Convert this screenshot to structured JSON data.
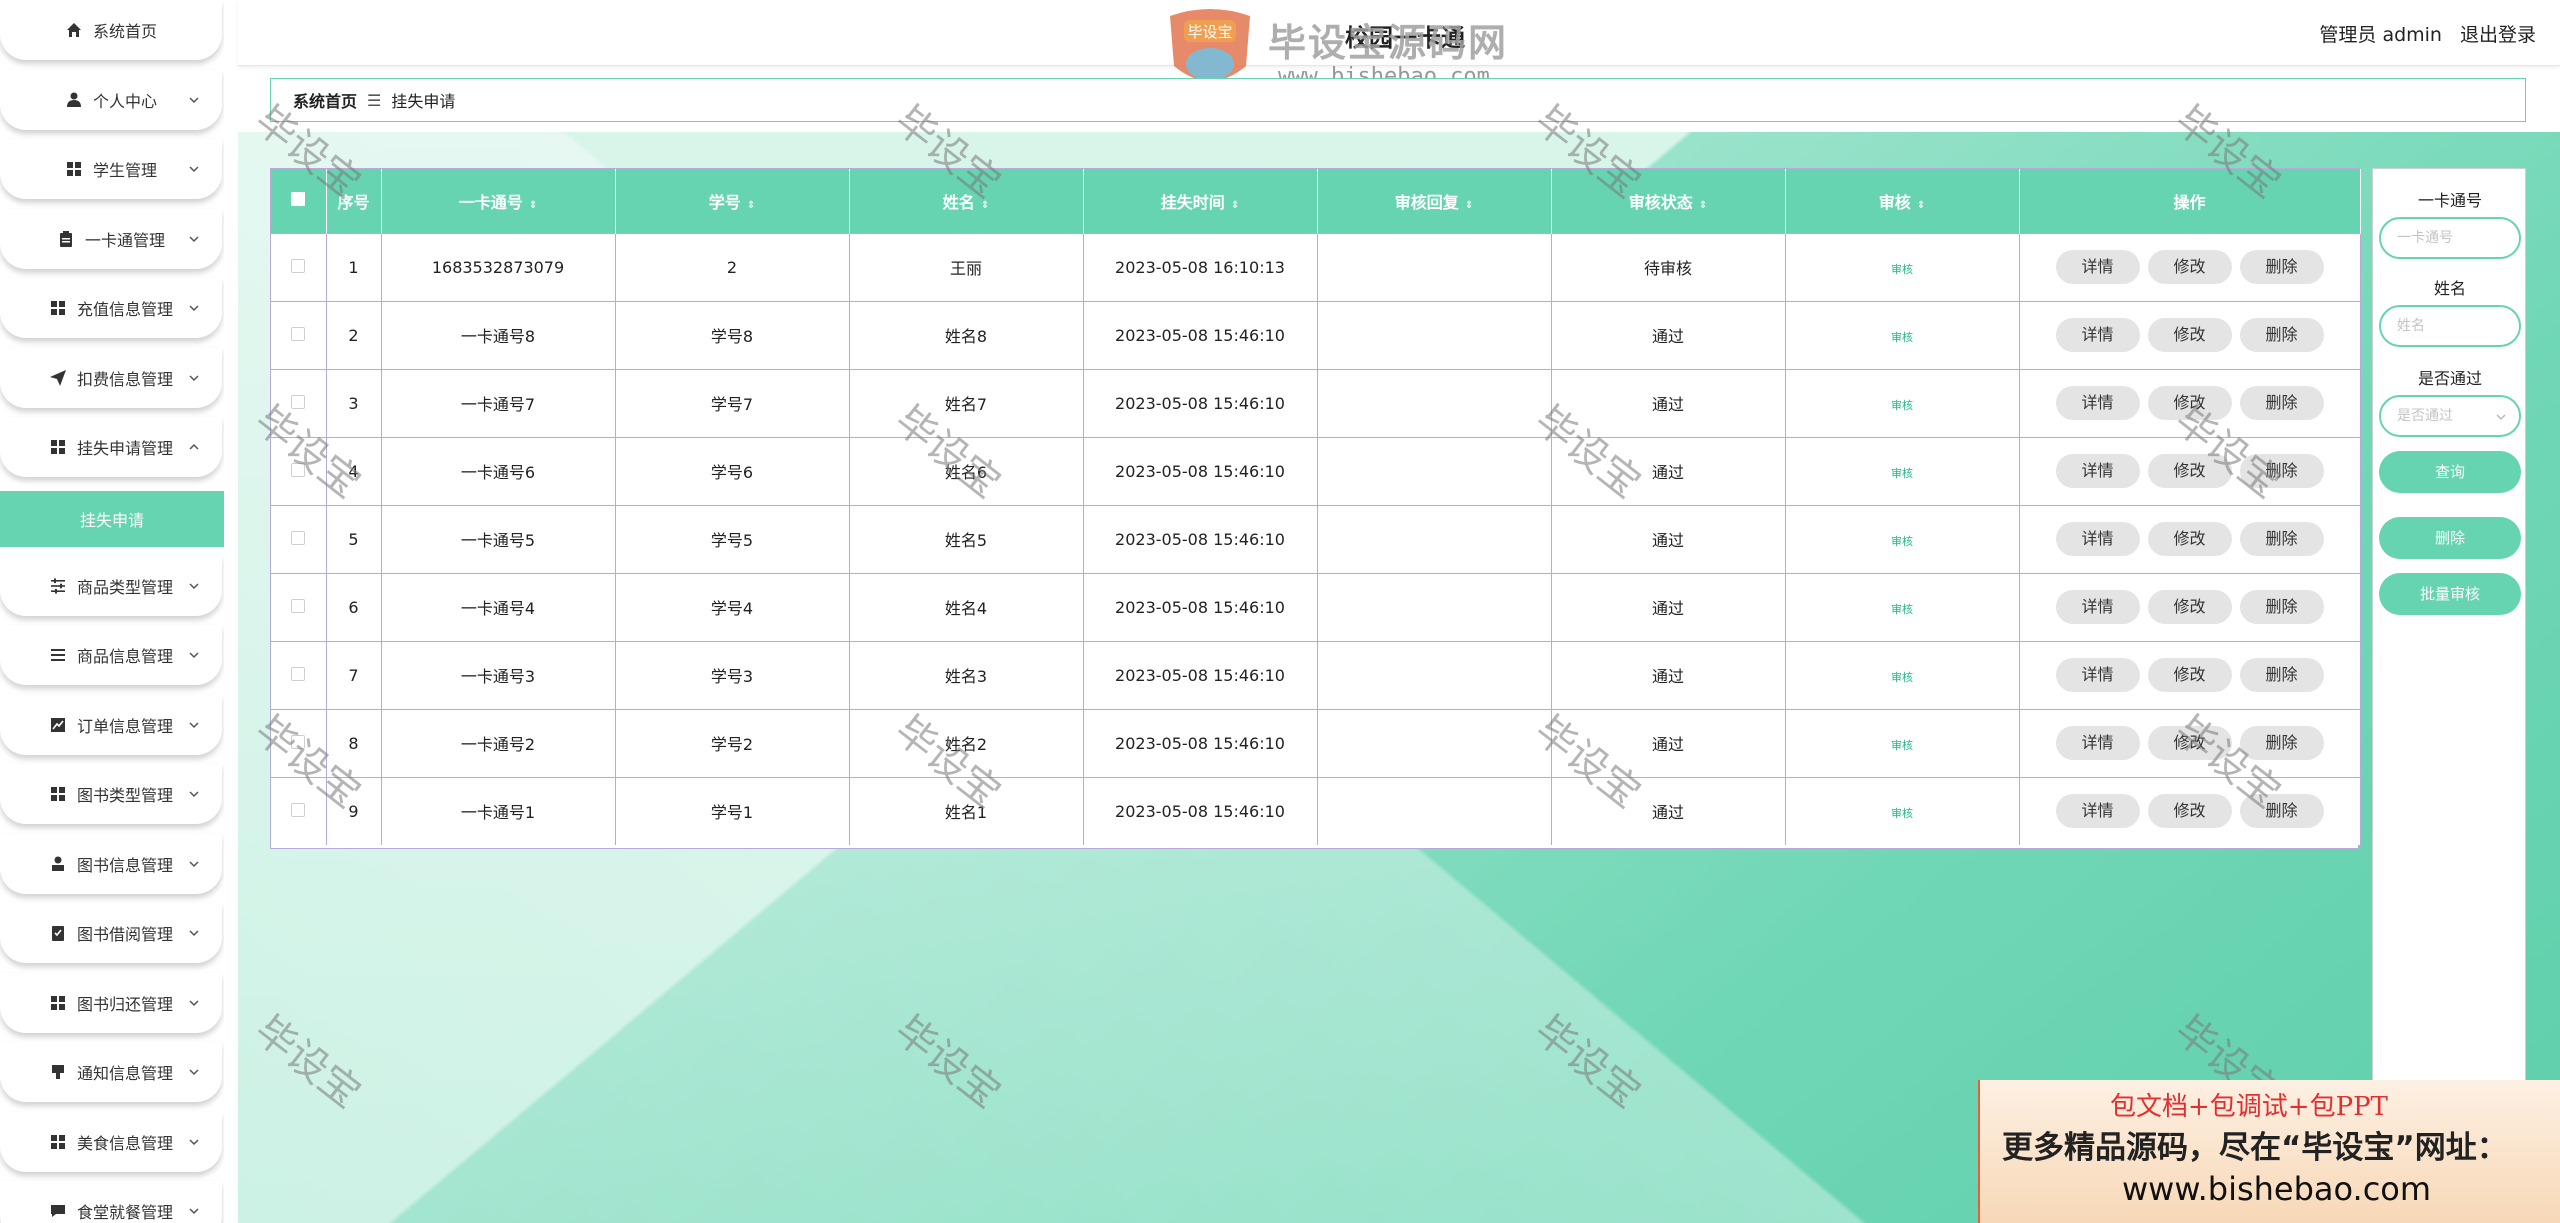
{
  "sidebar": {
    "items": [
      {
        "label": "系统首页",
        "icon": "home-icon",
        "chevron": false
      },
      {
        "label": "个人中心",
        "icon": "user-icon",
        "chevron": true
      },
      {
        "label": "学生管理",
        "icon": "grid-icon",
        "chevron": true
      },
      {
        "label": "一卡通管理",
        "icon": "clipboard-icon",
        "chevron": true
      },
      {
        "label": "充值信息管理",
        "icon": "grid-icon",
        "chevron": true
      },
      {
        "label": "扣费信息管理",
        "icon": "send-icon",
        "chevron": true
      },
      {
        "label": "挂失申请管理",
        "icon": "grid-icon",
        "chevron": true,
        "expanded": true
      },
      {
        "label": "商品类型管理",
        "icon": "sliders-icon",
        "chevron": true
      },
      {
        "label": "商品信息管理",
        "icon": "list-icon",
        "chevron": true
      },
      {
        "label": "订单信息管理",
        "icon": "chart-icon",
        "chevron": true
      },
      {
        "label": "图书类型管理",
        "icon": "grid-icon",
        "chevron": true
      },
      {
        "label": "图书信息管理",
        "icon": "person-icon",
        "chevron": true
      },
      {
        "label": "图书借阅管理",
        "icon": "checklist-icon",
        "chevron": true
      },
      {
        "label": "图书归还管理",
        "icon": "grid-icon",
        "chevron": true
      },
      {
        "label": "通知信息管理",
        "icon": "bell-icon",
        "chevron": true
      },
      {
        "label": "美食信息管理",
        "icon": "grid-icon",
        "chevron": true
      },
      {
        "label": "食堂就餐管理",
        "icon": "message-icon",
        "chevron": true
      }
    ],
    "active_sub": "挂失申请"
  },
  "header": {
    "title": "校园一卡通",
    "user_label": "管理员 admin",
    "logout_label": "退出登录"
  },
  "watermark": {
    "brand": "毕设宝源码网",
    "badge": "毕设宝",
    "url": "www.bishebao.com",
    "stamp": "毕设宝"
  },
  "breadcrumb": {
    "home": "系统首页",
    "separator": "☰",
    "current": "挂失申请"
  },
  "table": {
    "columns": [
      "序号",
      "一卡通号",
      "学号",
      "姓名",
      "挂失时间",
      "审核回复",
      "审核状态",
      "审核",
      "操作"
    ],
    "audit_link": "审核",
    "actions": {
      "detail": "详情",
      "edit": "修改",
      "delete": "删除"
    },
    "rows": [
      {
        "idx": "1",
        "card": "1683532873079",
        "student_no": "2",
        "name": "王丽",
        "time": "2023-05-08 16:10:13",
        "reply": "",
        "status": "待审核"
      },
      {
        "idx": "2",
        "card": "一卡通号8",
        "student_no": "学号8",
        "name": "姓名8",
        "time": "2023-05-08 15:46:10",
        "reply": "",
        "status": "通过"
      },
      {
        "idx": "3",
        "card": "一卡通号7",
        "student_no": "学号7",
        "name": "姓名7",
        "time": "2023-05-08 15:46:10",
        "reply": "",
        "status": "通过"
      },
      {
        "idx": "4",
        "card": "一卡通号6",
        "student_no": "学号6",
        "name": "姓名6",
        "time": "2023-05-08 15:46:10",
        "reply": "",
        "status": "通过"
      },
      {
        "idx": "5",
        "card": "一卡通号5",
        "student_no": "学号5",
        "name": "姓名5",
        "time": "2023-05-08 15:46:10",
        "reply": "",
        "status": "通过"
      },
      {
        "idx": "6",
        "card": "一卡通号4",
        "student_no": "学号4",
        "name": "姓名4",
        "time": "2023-05-08 15:46:10",
        "reply": "",
        "status": "通过"
      },
      {
        "idx": "7",
        "card": "一卡通号3",
        "student_no": "学号3",
        "name": "姓名3",
        "time": "2023-05-08 15:46:10",
        "reply": "",
        "status": "通过"
      },
      {
        "idx": "8",
        "card": "一卡通号2",
        "student_no": "学号2",
        "name": "姓名2",
        "time": "2023-05-08 15:46:10",
        "reply": "",
        "status": "通过"
      },
      {
        "idx": "9",
        "card": "一卡通号1",
        "student_no": "学号1",
        "name": "姓名1",
        "time": "2023-05-08 15:46:10",
        "reply": "",
        "status": "通过"
      }
    ]
  },
  "search": {
    "card_label": "一卡通号",
    "card_placeholder": "一卡通号",
    "name_label": "姓名",
    "name_placeholder": "姓名",
    "pass_label": "是否通过",
    "pass_placeholder": "是否通过",
    "query_button": "查询",
    "delete_button": "删除",
    "batch_button": "批量审核"
  },
  "ad": {
    "line1": "包文档+包调试+包PPT",
    "line2": "更多精品源码，尽在“毕设宝”网址：",
    "line3": "www.bishebao.com"
  },
  "colors": {
    "accent": "#66d4b1",
    "audit_link": "#2bb58e",
    "table_border": "#b9a9d9"
  }
}
